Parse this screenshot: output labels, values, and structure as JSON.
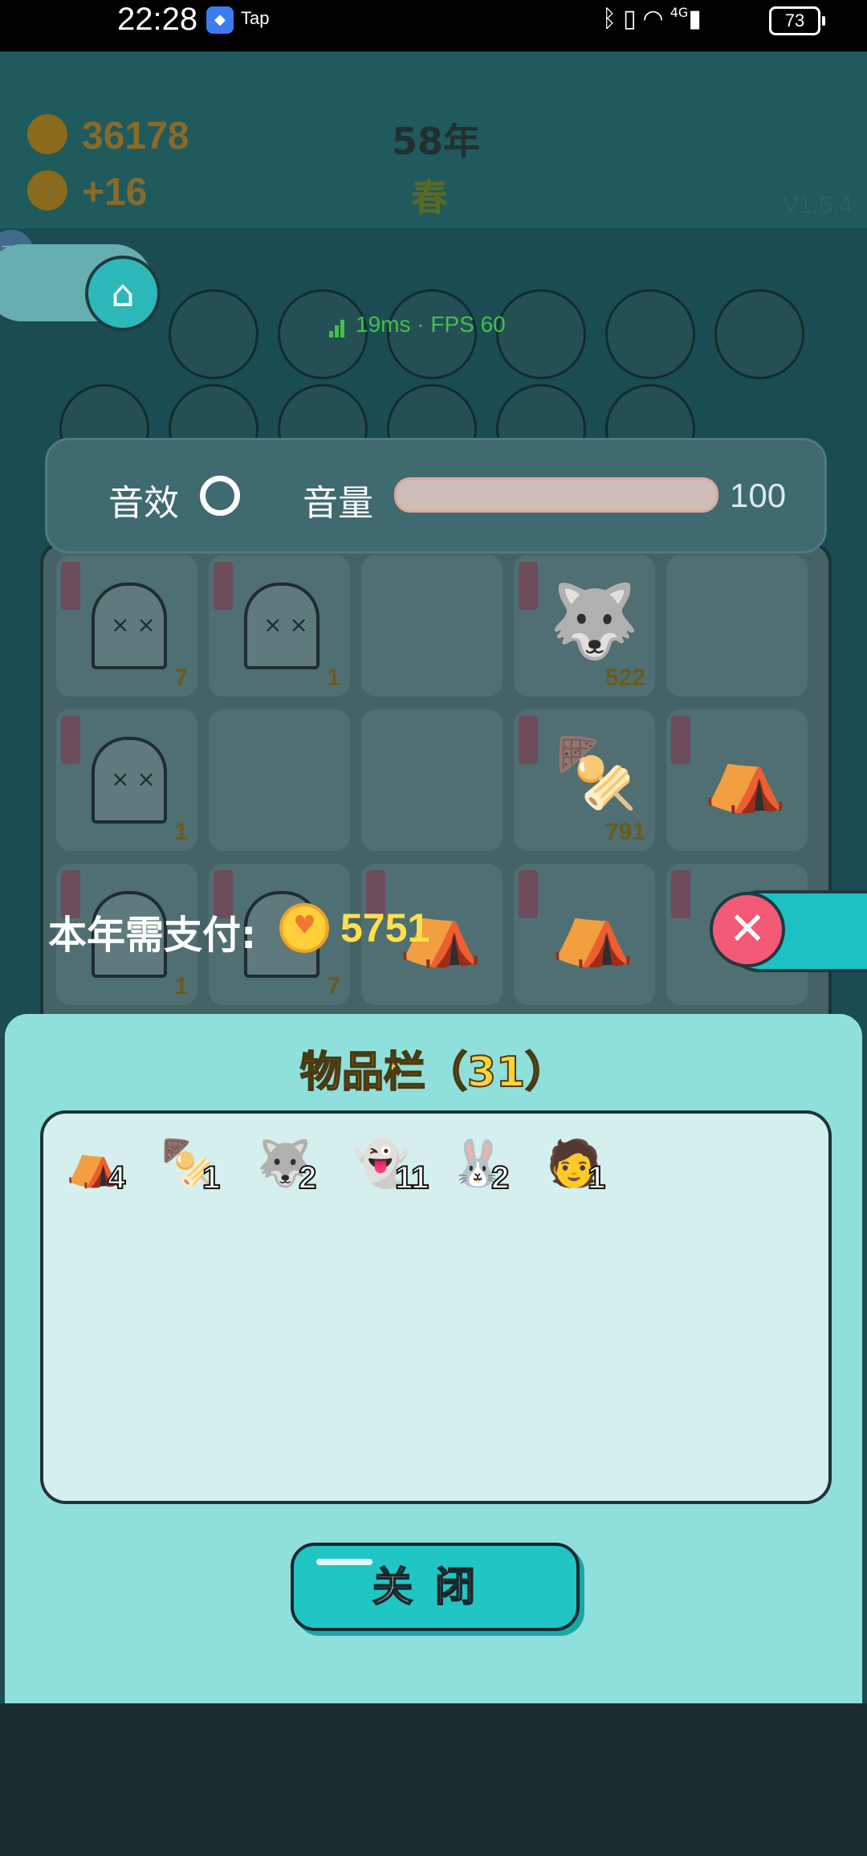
{
  "status_bar": {
    "time": "22:28",
    "app_label": "Tap",
    "network_label": "4G",
    "battery": "73"
  },
  "hud": {
    "coins": "36178",
    "income": "+16",
    "year": "58年",
    "season": "春",
    "version": "V1.5.4"
  },
  "debug": {
    "fps_text": "19ms · FPS 60"
  },
  "settings": {
    "sfx_label": "音效",
    "volume_label": "音量",
    "volume_value": "100"
  },
  "board": {
    "cells": [
      {
        "count": "7"
      },
      {
        "count": "1"
      },
      {
        "count": ""
      },
      {
        "count": "522"
      },
      {
        "count": ""
      },
      {
        "count": "1"
      },
      {
        "count": ""
      },
      {
        "count": ""
      },
      {
        "count": "791"
      },
      {
        "count": ""
      },
      {
        "count": "1"
      },
      {
        "count": "7"
      },
      {
        "count": ""
      },
      {
        "count": ""
      },
      {
        "count": ""
      }
    ]
  },
  "payment": {
    "label": "本年需支付:",
    "amount": "5751"
  },
  "inventory": {
    "title": "物品栏（31）",
    "items": [
      {
        "icon": "lantern-tent-icon",
        "count": "4"
      },
      {
        "icon": "snake-skewer-icon",
        "count": "1"
      },
      {
        "icon": "husky-king-icon",
        "count": "2"
      },
      {
        "icon": "ghost-icon",
        "count": "11"
      },
      {
        "icon": "rabbit-icon",
        "count": "2"
      },
      {
        "icon": "thief-icon",
        "count": "1"
      }
    ],
    "close_label": "关闭"
  },
  "colors": {
    "sheet_bg": "#8fe0dc",
    "title_yellow": "#ffd23a",
    "close_button": "#1fc6c4",
    "pay_amount": "#ffe04a"
  }
}
